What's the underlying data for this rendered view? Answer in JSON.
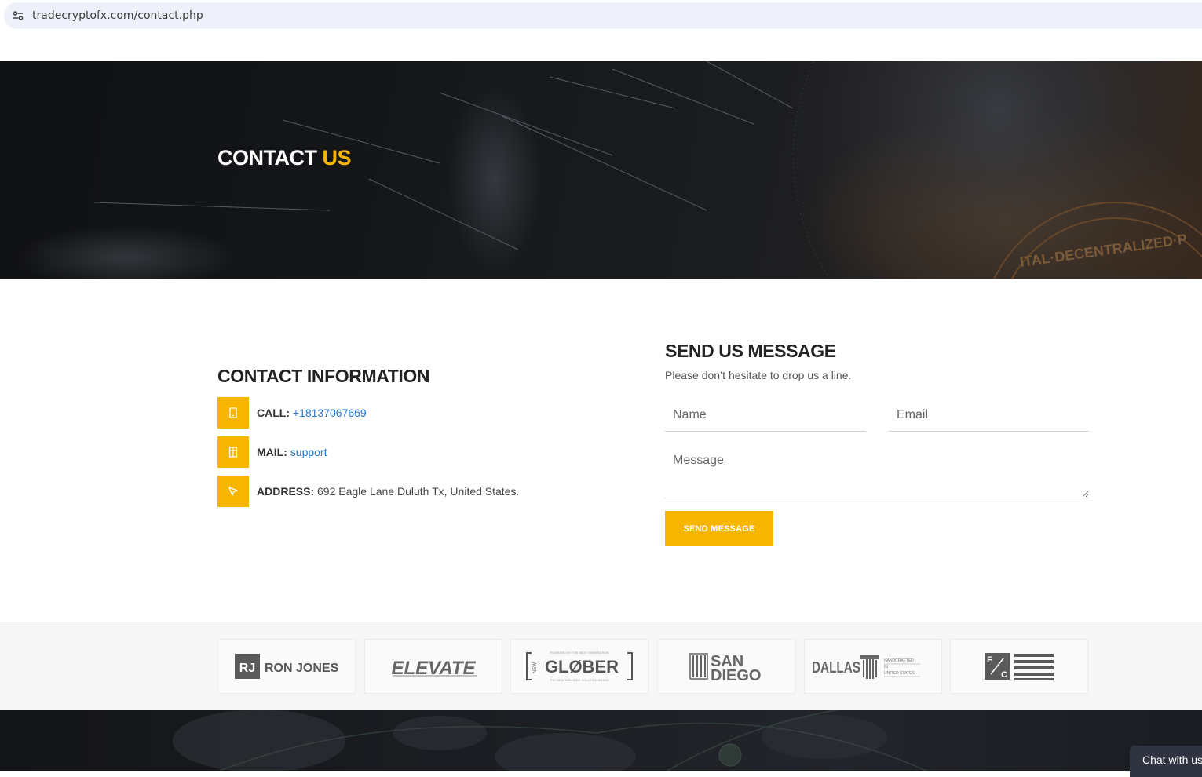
{
  "browser": {
    "url": "tradecryptofx.com/contact.php",
    "site_info_icon": "site-settings-icon"
  },
  "hero": {
    "title_main": "CONTACT",
    "title_accent": "US",
    "coin_text": "ITAL·DECENTRALIZED·P"
  },
  "contact_info": {
    "heading": "CONTACT INFORMATION",
    "items": [
      {
        "icon": "phone-icon",
        "label": "CALL:",
        "value": "+18137067669"
      },
      {
        "icon": "mail-icon",
        "label": "MAIL:",
        "value": "support"
      },
      {
        "icon": "location-icon",
        "label": "ADDRESS:",
        "value": "692 Eagle Lane Duluth Tx, United States."
      }
    ]
  },
  "form": {
    "heading": "SEND US MESSAGE",
    "subtitle": "Please don’t hesitate to drop us a line.",
    "name_placeholder": "Name",
    "email_placeholder": "Email",
    "message_placeholder": "Message",
    "submit_label": "SEND MESSAGE"
  },
  "partners": {
    "ron_jones": {
      "mark": "RJ",
      "name": "RON JONES"
    },
    "elevate": {
      "name": "ELEVATE"
    },
    "glober": {
      "prefix": "NEW",
      "name": "GLØBER",
      "top_text": "POWERED BY THE NEXT GENERATION",
      "bottom_text": "THE NEW COLORED SOLUTION BRAND"
    },
    "san_diego": {
      "line1": "SAN",
      "line2": "DIEGO"
    },
    "dallas": {
      "name": "DALLAS",
      "tag1": "HANDCRAFTED",
      "tag2": "IN",
      "tag3": "UNITED STATES"
    },
    "fc": {
      "mark_f": "F",
      "mark_c": "C"
    }
  },
  "chat": {
    "label": "Chat with us"
  },
  "colors": {
    "accent": "#f7b500",
    "link": "#1f78d1",
    "heading": "#222222"
  }
}
